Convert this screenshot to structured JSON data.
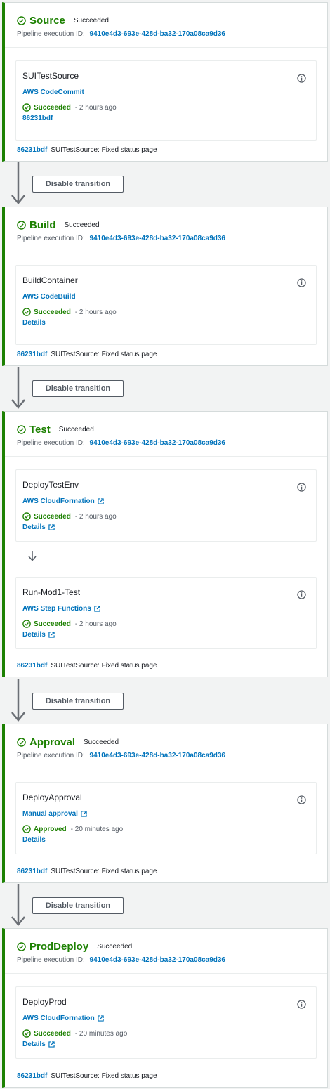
{
  "labels": {
    "exec_prefix": "Pipeline execution ID:",
    "disable_transition": "Disable transition"
  },
  "colors": {
    "success": "#1d8102",
    "link": "#0073bb"
  },
  "stages": [
    {
      "name": "Source",
      "status": "Succeeded",
      "execution_id": "9410e4d3-693e-428d-ba32-170a08ca9d36",
      "actions": [
        {
          "name": "SUITestSource",
          "provider": "AWS CodeCommit",
          "external": false,
          "status": "Succeeded",
          "time": "2 hours ago",
          "link": "86231bdf",
          "link_external": false
        }
      ],
      "commit_id": "86231bdf",
      "commit_message": "SUITestSource: Fixed status page"
    },
    {
      "name": "Build",
      "status": "Succeeded",
      "execution_id": "9410e4d3-693e-428d-ba32-170a08ca9d36",
      "actions": [
        {
          "name": "BuildContainer",
          "provider": "AWS CodeBuild",
          "external": false,
          "status": "Succeeded",
          "time": "2 hours ago",
          "link": "Details",
          "link_external": false
        }
      ],
      "commit_id": "86231bdf",
      "commit_message": "SUITestSource: Fixed status page"
    },
    {
      "name": "Test",
      "status": "Succeeded",
      "execution_id": "9410e4d3-693e-428d-ba32-170a08ca9d36",
      "actions": [
        {
          "name": "DeployTestEnv",
          "provider": "AWS CloudFormation",
          "external": true,
          "status": "Succeeded",
          "time": "2 hours ago",
          "link": "Details",
          "link_external": true
        },
        {
          "name": "Run-Mod1-Test",
          "provider": "AWS Step Functions",
          "external": true,
          "status": "Succeeded",
          "time": "2 hours ago",
          "link": "Details",
          "link_external": true
        }
      ],
      "commit_id": "86231bdf",
      "commit_message": "SUITestSource: Fixed status page"
    },
    {
      "name": "Approval",
      "status": "Succeeded",
      "execution_id": "9410e4d3-693e-428d-ba32-170a08ca9d36",
      "actions": [
        {
          "name": "DeployApproval",
          "provider": "Manual approval",
          "external": true,
          "status": "Approved",
          "time": "20 minutes ago",
          "link": "Details",
          "link_external": false
        }
      ],
      "commit_id": "86231bdf",
      "commit_message": "SUITestSource: Fixed status page"
    },
    {
      "name": "ProdDeploy",
      "status": "Succeeded",
      "execution_id": "9410e4d3-693e-428d-ba32-170a08ca9d36",
      "actions": [
        {
          "name": "DeployProd",
          "provider": "AWS CloudFormation",
          "external": true,
          "status": "Succeeded",
          "time": "20 minutes ago",
          "link": "Details",
          "link_external": true
        }
      ],
      "commit_id": "86231bdf",
      "commit_message": "SUITestSource: Fixed status page"
    }
  ]
}
